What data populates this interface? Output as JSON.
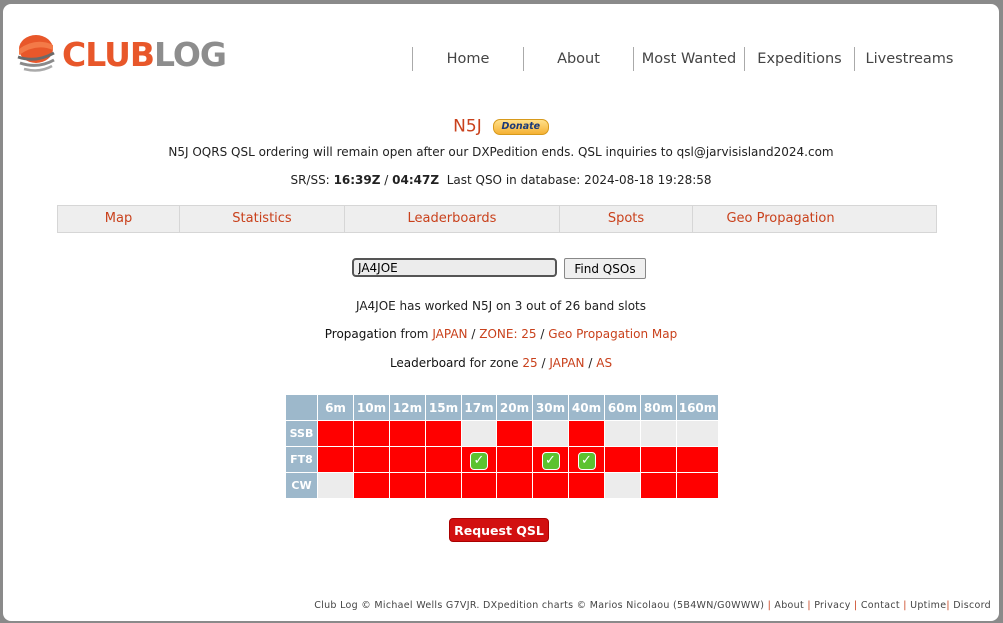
{
  "brand": {
    "club": "CLUB",
    "log": "LOG"
  },
  "nav": [
    {
      "label": "Home"
    },
    {
      "label": "About"
    },
    {
      "label": "Most Wanted"
    },
    {
      "label": "Expeditions"
    },
    {
      "label": "Livestreams"
    }
  ],
  "header": {
    "callsign": "N5J",
    "donate_label": "Donate",
    "notice": "N5J OQRS QSL ordering will remain open after our DXPedition ends. QSL inquiries to qsl@jarvisisland2024.com",
    "srss_label": "SR/SS:",
    "sunrise": "16:39Z",
    "sunset": "04:47Z",
    "last_qso_label": "Last QSO in database:",
    "last_qso": "2024-08-18 19:28:58"
  },
  "tabs": [
    {
      "label": "Map"
    },
    {
      "label": "Statistics"
    },
    {
      "label": "Leaderboards"
    },
    {
      "label": "Spots"
    },
    {
      "label": "Geo Propagation"
    }
  ],
  "search": {
    "value": "JA4JOE",
    "button_label": "Find QSOs"
  },
  "result": {
    "summary": "JA4JOE has worked N5J on 3 out of 26 band slots",
    "propagation_heading": "Propagation",
    "propagation_from": "from",
    "propagation_country": "JAPAN",
    "propagation_zone": "ZONE: 25",
    "propagation_map": "Geo Propagation Map",
    "leaderboard_heading": "Leaderboard",
    "leaderboard_for_zone": "for zone",
    "leaderboard_zone": "25",
    "leaderboard_country": "JAPAN",
    "leaderboard_continent": "AS",
    "slash": "/"
  },
  "slots": {
    "bands": [
      "6m",
      "10m",
      "12m",
      "15m",
      "17m",
      "20m",
      "30m",
      "40m",
      "60m",
      "80m",
      "160m"
    ],
    "modes": [
      {
        "name": "SSB",
        "cells": [
          "red",
          "red",
          "red",
          "red",
          "grey",
          "red",
          "grey",
          "red",
          "grey",
          "grey",
          "grey"
        ]
      },
      {
        "name": "FT8",
        "cells": [
          "red",
          "red",
          "red",
          "red",
          "worked",
          "red",
          "worked",
          "worked",
          "red",
          "red",
          "red"
        ]
      },
      {
        "name": "CW",
        "cells": [
          "grey",
          "red",
          "red",
          "red",
          "red",
          "red",
          "red",
          "red",
          "grey",
          "red",
          "red"
        ]
      }
    ],
    "colors": {
      "red": "#ff0000",
      "grey": "#ececec",
      "header": "#9db8cb",
      "worked": "#5cc230"
    },
    "check_glyph": "✓"
  },
  "request_qsl_label": "Request QSL",
  "footer": {
    "credit": "Club Log © Michael Wells G7VJR. DXpedition charts © Marios Nicolaou (5B4WN/G0WWW)",
    "links": [
      "About",
      "Privacy",
      "Contact",
      "Uptime",
      "Discord"
    ]
  }
}
